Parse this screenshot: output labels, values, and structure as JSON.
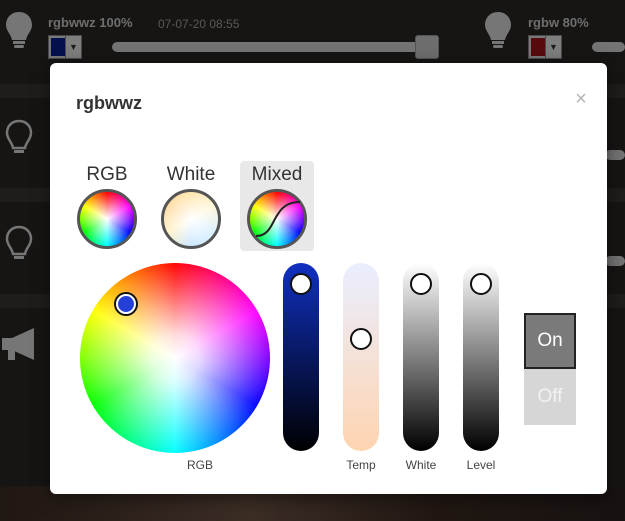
{
  "background": {
    "devices": [
      {
        "title": "rgbwwz 100%",
        "timestamp": "07-07-20 08:55",
        "swatch_color": "#0a1f8f"
      },
      {
        "title": "rgbw 80%",
        "timestamp": "",
        "swatch_color": "#9e1418"
      }
    ]
  },
  "modal": {
    "title": "rgbwwz",
    "close_icon": "×",
    "modes": [
      {
        "label": "RGB",
        "icon": "rgb-wheel-icon",
        "active": false
      },
      {
        "label": "White",
        "icon": "white-wheel-icon",
        "active": false
      },
      {
        "label": "Mixed",
        "icon": "mixed-wheel-icon",
        "active": true
      }
    ],
    "color_wheel": {
      "label": "RGB",
      "selected_color": "#2440d8"
    },
    "sliders": [
      {
        "label": "",
        "name": "blue-brightness",
        "level": 0.98,
        "colors": [
          "#1030c0",
          "#000000"
        ]
      },
      {
        "label": "Temp",
        "name": "temperature",
        "level": 0.62,
        "colors": [
          "#e9eeff",
          "#ffd4b0"
        ]
      },
      {
        "label": "White",
        "name": "white",
        "level": 0.98,
        "colors": [
          "#ffffff",
          "#000000"
        ]
      },
      {
        "label": "Level",
        "name": "level",
        "level": 0.98,
        "colors": [
          "#ffffff",
          "#000000"
        ]
      }
    ],
    "power": {
      "on_label": "On",
      "off_label": "Off",
      "state": "on"
    }
  }
}
